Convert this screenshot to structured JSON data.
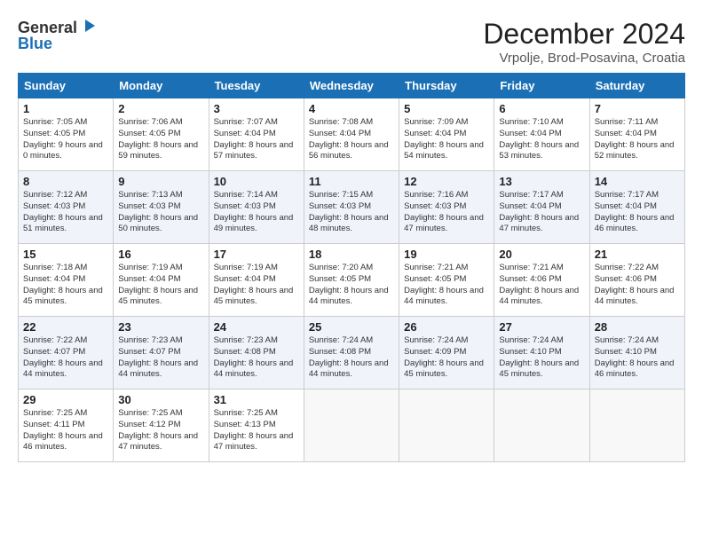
{
  "header": {
    "logo_general": "General",
    "logo_blue": "Blue",
    "month_title": "December 2024",
    "location": "Vrpolje, Brod-Posavina, Croatia"
  },
  "days_of_week": [
    "Sunday",
    "Monday",
    "Tuesday",
    "Wednesday",
    "Thursday",
    "Friday",
    "Saturday"
  ],
  "weeks": [
    [
      {
        "day": 1,
        "sunrise": "Sunrise: 7:05 AM",
        "sunset": "Sunset: 4:05 PM",
        "daylight": "Daylight: 9 hours and 0 minutes."
      },
      {
        "day": 2,
        "sunrise": "Sunrise: 7:06 AM",
        "sunset": "Sunset: 4:05 PM",
        "daylight": "Daylight: 8 hours and 59 minutes."
      },
      {
        "day": 3,
        "sunrise": "Sunrise: 7:07 AM",
        "sunset": "Sunset: 4:04 PM",
        "daylight": "Daylight: 8 hours and 57 minutes."
      },
      {
        "day": 4,
        "sunrise": "Sunrise: 7:08 AM",
        "sunset": "Sunset: 4:04 PM",
        "daylight": "Daylight: 8 hours and 56 minutes."
      },
      {
        "day": 5,
        "sunrise": "Sunrise: 7:09 AM",
        "sunset": "Sunset: 4:04 PM",
        "daylight": "Daylight: 8 hours and 54 minutes."
      },
      {
        "day": 6,
        "sunrise": "Sunrise: 7:10 AM",
        "sunset": "Sunset: 4:04 PM",
        "daylight": "Daylight: 8 hours and 53 minutes."
      },
      {
        "day": 7,
        "sunrise": "Sunrise: 7:11 AM",
        "sunset": "Sunset: 4:04 PM",
        "daylight": "Daylight: 8 hours and 52 minutes."
      }
    ],
    [
      {
        "day": 8,
        "sunrise": "Sunrise: 7:12 AM",
        "sunset": "Sunset: 4:03 PM",
        "daylight": "Daylight: 8 hours and 51 minutes."
      },
      {
        "day": 9,
        "sunrise": "Sunrise: 7:13 AM",
        "sunset": "Sunset: 4:03 PM",
        "daylight": "Daylight: 8 hours and 50 minutes."
      },
      {
        "day": 10,
        "sunrise": "Sunrise: 7:14 AM",
        "sunset": "Sunset: 4:03 PM",
        "daylight": "Daylight: 8 hours and 49 minutes."
      },
      {
        "day": 11,
        "sunrise": "Sunrise: 7:15 AM",
        "sunset": "Sunset: 4:03 PM",
        "daylight": "Daylight: 8 hours and 48 minutes."
      },
      {
        "day": 12,
        "sunrise": "Sunrise: 7:16 AM",
        "sunset": "Sunset: 4:03 PM",
        "daylight": "Daylight: 8 hours and 47 minutes."
      },
      {
        "day": 13,
        "sunrise": "Sunrise: 7:17 AM",
        "sunset": "Sunset: 4:04 PM",
        "daylight": "Daylight: 8 hours and 47 minutes."
      },
      {
        "day": 14,
        "sunrise": "Sunrise: 7:17 AM",
        "sunset": "Sunset: 4:04 PM",
        "daylight": "Daylight: 8 hours and 46 minutes."
      }
    ],
    [
      {
        "day": 15,
        "sunrise": "Sunrise: 7:18 AM",
        "sunset": "Sunset: 4:04 PM",
        "daylight": "Daylight: 8 hours and 45 minutes."
      },
      {
        "day": 16,
        "sunrise": "Sunrise: 7:19 AM",
        "sunset": "Sunset: 4:04 PM",
        "daylight": "Daylight: 8 hours and 45 minutes."
      },
      {
        "day": 17,
        "sunrise": "Sunrise: 7:19 AM",
        "sunset": "Sunset: 4:04 PM",
        "daylight": "Daylight: 8 hours and 45 minutes."
      },
      {
        "day": 18,
        "sunrise": "Sunrise: 7:20 AM",
        "sunset": "Sunset: 4:05 PM",
        "daylight": "Daylight: 8 hours and 44 minutes."
      },
      {
        "day": 19,
        "sunrise": "Sunrise: 7:21 AM",
        "sunset": "Sunset: 4:05 PM",
        "daylight": "Daylight: 8 hours and 44 minutes."
      },
      {
        "day": 20,
        "sunrise": "Sunrise: 7:21 AM",
        "sunset": "Sunset: 4:06 PM",
        "daylight": "Daylight: 8 hours and 44 minutes."
      },
      {
        "day": 21,
        "sunrise": "Sunrise: 7:22 AM",
        "sunset": "Sunset: 4:06 PM",
        "daylight": "Daylight: 8 hours and 44 minutes."
      }
    ],
    [
      {
        "day": 22,
        "sunrise": "Sunrise: 7:22 AM",
        "sunset": "Sunset: 4:07 PM",
        "daylight": "Daylight: 8 hours and 44 minutes."
      },
      {
        "day": 23,
        "sunrise": "Sunrise: 7:23 AM",
        "sunset": "Sunset: 4:07 PM",
        "daylight": "Daylight: 8 hours and 44 minutes."
      },
      {
        "day": 24,
        "sunrise": "Sunrise: 7:23 AM",
        "sunset": "Sunset: 4:08 PM",
        "daylight": "Daylight: 8 hours and 44 minutes."
      },
      {
        "day": 25,
        "sunrise": "Sunrise: 7:24 AM",
        "sunset": "Sunset: 4:08 PM",
        "daylight": "Daylight: 8 hours and 44 minutes."
      },
      {
        "day": 26,
        "sunrise": "Sunrise: 7:24 AM",
        "sunset": "Sunset: 4:09 PM",
        "daylight": "Daylight: 8 hours and 45 minutes."
      },
      {
        "day": 27,
        "sunrise": "Sunrise: 7:24 AM",
        "sunset": "Sunset: 4:10 PM",
        "daylight": "Daylight: 8 hours and 45 minutes."
      },
      {
        "day": 28,
        "sunrise": "Sunrise: 7:24 AM",
        "sunset": "Sunset: 4:10 PM",
        "daylight": "Daylight: 8 hours and 46 minutes."
      }
    ],
    [
      {
        "day": 29,
        "sunrise": "Sunrise: 7:25 AM",
        "sunset": "Sunset: 4:11 PM",
        "daylight": "Daylight: 8 hours and 46 minutes."
      },
      {
        "day": 30,
        "sunrise": "Sunrise: 7:25 AM",
        "sunset": "Sunset: 4:12 PM",
        "daylight": "Daylight: 8 hours and 47 minutes."
      },
      {
        "day": 31,
        "sunrise": "Sunrise: 7:25 AM",
        "sunset": "Sunset: 4:13 PM",
        "daylight": "Daylight: 8 hours and 47 minutes."
      },
      null,
      null,
      null,
      null
    ]
  ]
}
